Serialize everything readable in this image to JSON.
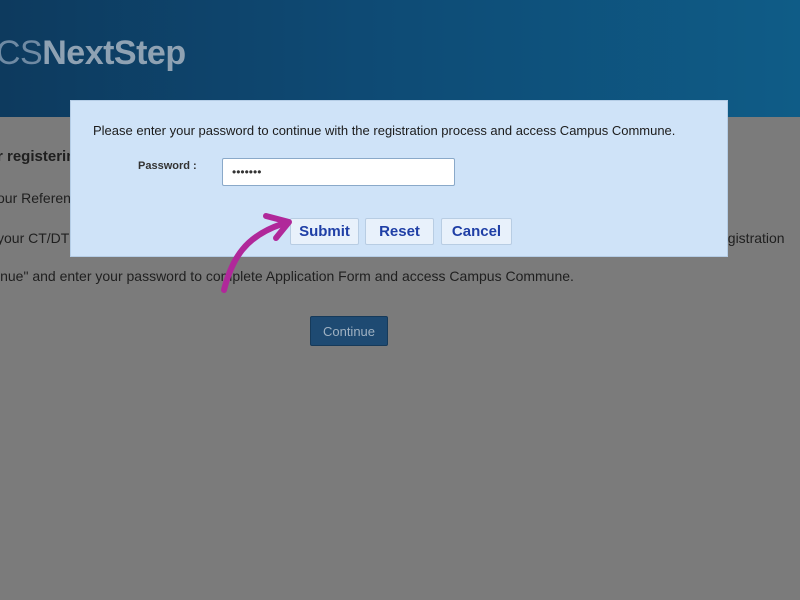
{
  "header": {
    "logo_prefix": "CS",
    "logo_main": "NextStep"
  },
  "background": {
    "heading": "r registerin",
    "line1": "our Referen",
    "line2": "your CT/DT",
    "line2_right": "egistration",
    "line3": "inue\" and enter your password to complete Application Form and access Campus Commune.",
    "continue_label": "Continue"
  },
  "modal": {
    "message": "Please enter your password to continue with the registration process and access Campus Commune.",
    "password_label": "Password :",
    "password_value": "•••••••",
    "submit_label": "Submit",
    "reset_label": "Reset",
    "cancel_label": "Cancel"
  },
  "colors": {
    "header": "#0e4a74",
    "modal_bg": "#cfe3f8",
    "button_text": "#1f3fa6",
    "annotation_arrow": "#b0289a"
  },
  "icons": {
    "annotation": "curved-arrow-icon"
  }
}
